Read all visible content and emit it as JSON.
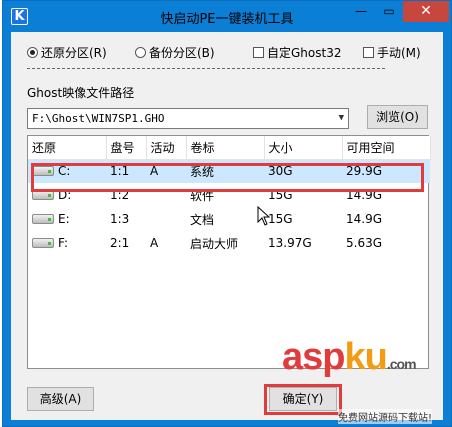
{
  "window": {
    "title": "快启动PE一键装机工具",
    "app_icon_letter": "K",
    "min_label": "—",
    "max_label": "▭",
    "close_label": "✕"
  },
  "options": {
    "restore": "还原分区(R)",
    "backup": "备份分区(B)",
    "custom_ghost": "自定Ghost32",
    "manual": "手动(M)",
    "selected": "restore"
  },
  "image_path": {
    "label": "Ghost映像文件路径",
    "value": "F:\\Ghost\\WIN7SP1.GHO",
    "browse_label": "浏览(O)"
  },
  "table": {
    "columns": [
      "还原",
      "盘号",
      "活动",
      "卷标",
      "大小",
      "可用空间"
    ],
    "rows": [
      {
        "drive": "C:",
        "disk": "1:1",
        "active": "A",
        "label": "系统",
        "size": "30G",
        "free": "29.9G",
        "selected": true
      },
      {
        "drive": "D:",
        "disk": "1:2",
        "active": "",
        "label": "软件",
        "size": "15G",
        "free": "14.9G",
        "selected": false
      },
      {
        "drive": "E:",
        "disk": "1:3",
        "active": "",
        "label": "文档",
        "size": "15G",
        "free": "14.9G",
        "selected": false
      },
      {
        "drive": "F:",
        "disk": "2:1",
        "active": "A",
        "label": "启动大师",
        "size": "13.97G",
        "free": "5.63G",
        "selected": false
      }
    ]
  },
  "buttons": {
    "advanced": "高级(A)",
    "ok": "确定(Y)"
  },
  "watermark": {
    "asp": "asp",
    "ku": "ku",
    "com": ".com",
    "sub": "免费网站源码下载站!"
  },
  "colors": {
    "title_bar": "#0b7fd6",
    "highlight_red": "#e23b3b",
    "row_selected": "#cce8ff"
  }
}
